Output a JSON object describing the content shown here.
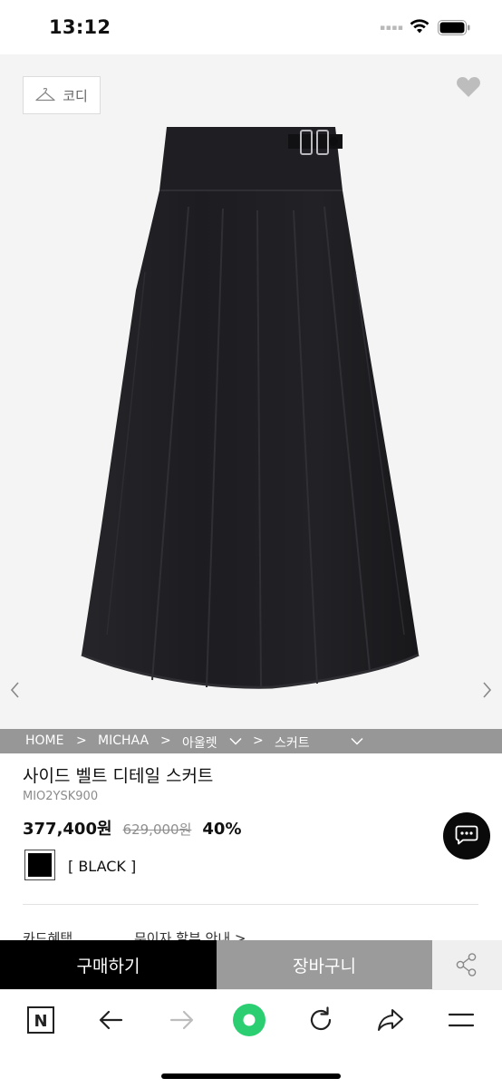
{
  "status_bar": {
    "time": "13:12",
    "signal_dots": "▪▪▪▪"
  },
  "product_image": {
    "codi_label": "코디",
    "wishlisted": false
  },
  "breadcrumb": {
    "items": [
      "HOME",
      "MICHAA",
      "아울렛",
      "스커트"
    ],
    "separator": ">"
  },
  "product": {
    "name": "사이드 벨트 디테일 스커트",
    "code": "MIO2YSK900",
    "sale_price": "377,400원",
    "original_price": "629,000원",
    "discount": "40%",
    "color_name": "[ BLACK ]",
    "color_hex": "#000000"
  },
  "info_peek": {
    "benefit": "카드혜택",
    "shipping": "무이자 할부 안내 >"
  },
  "action_bar": {
    "buy_label": "구매하기",
    "cart_label": "장바구니"
  },
  "toolbar": {
    "naver_label": "N"
  },
  "colors": {
    "accent_green": "#2bcf71",
    "breadcrumb_bg": "#979797",
    "cart_bg": "#9b9b9b"
  }
}
